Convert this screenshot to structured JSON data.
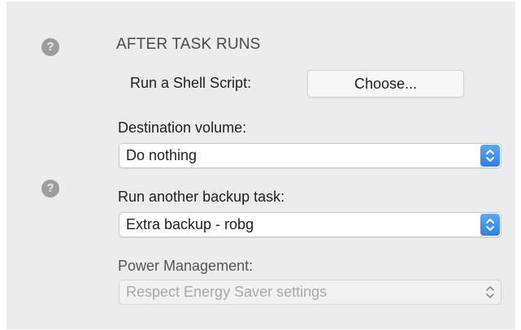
{
  "after_task": {
    "heading": "AFTER TASK RUNS",
    "shell_script_label": "Run a Shell Script:",
    "choose_button": "Choose..."
  },
  "destination_volume": {
    "label": "Destination volume:",
    "selected": "Do nothing"
  },
  "another_backup": {
    "label": "Run another backup task:",
    "selected": "Extra backup - robg"
  },
  "power_management": {
    "label": "Power Management:",
    "selected": "Respect Energy Saver settings",
    "enabled": false
  },
  "help_icon_glyph": "?",
  "icons": [
    "help-icon",
    "chevron-updown-icon"
  ],
  "colors": {
    "panel_background": "#ececec",
    "stepper_accent": "#2f7fe0",
    "help_icon": "#9d9d9d"
  }
}
